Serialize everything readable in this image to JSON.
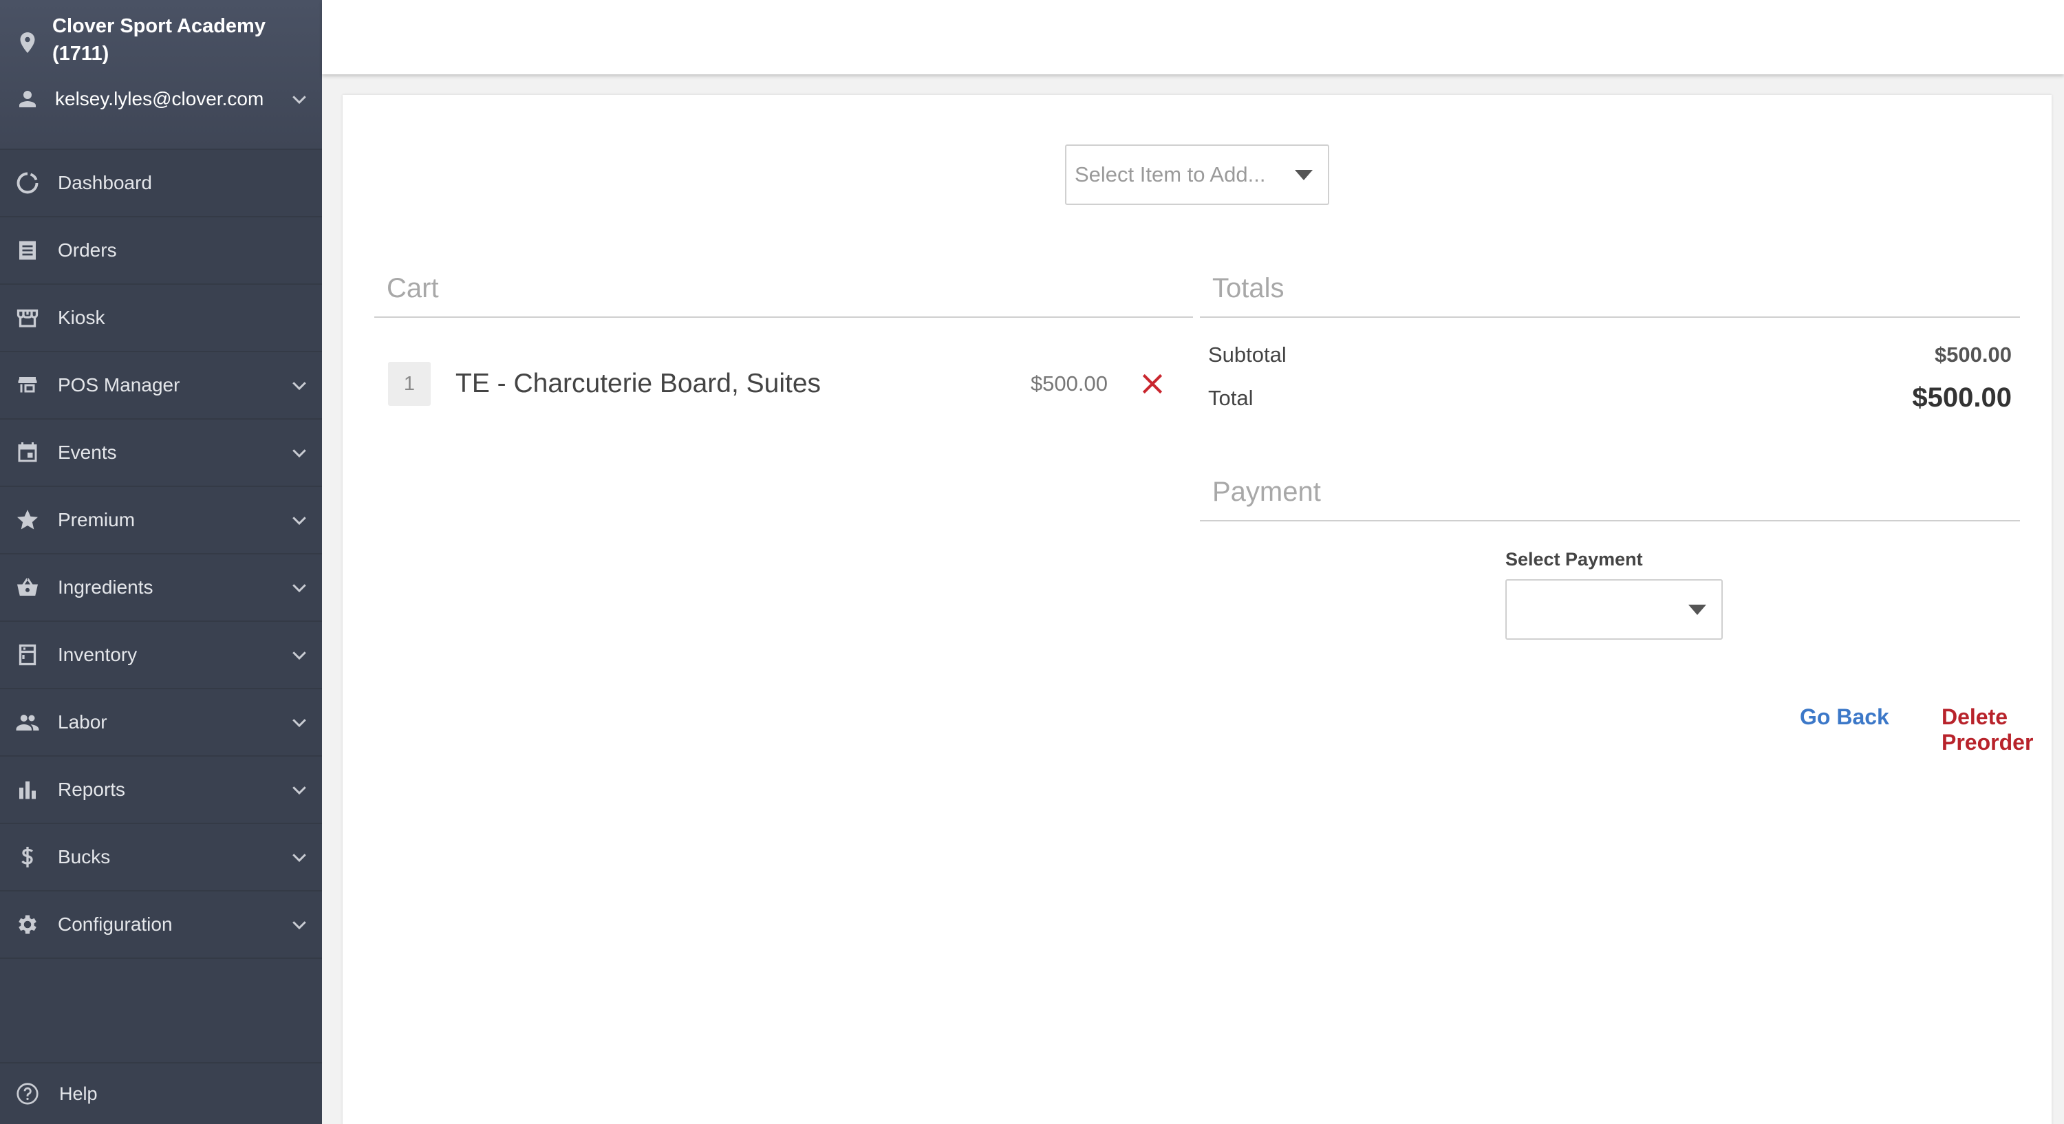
{
  "sidebar": {
    "venue_name": "Clover Sport Academy (1711)",
    "user_email": "kelsey.lyles@clover.com",
    "items": [
      {
        "label": "Dashboard",
        "icon": "dashboard-icon",
        "expandable": false
      },
      {
        "label": "Orders",
        "icon": "orders-icon",
        "expandable": false
      },
      {
        "label": "Kiosk",
        "icon": "kiosk-icon",
        "expandable": false
      },
      {
        "label": "POS Manager",
        "icon": "store-icon",
        "expandable": true
      },
      {
        "label": "Events",
        "icon": "calendar-icon",
        "expandable": true
      },
      {
        "label": "Premium",
        "icon": "star-icon",
        "expandable": true
      },
      {
        "label": "Ingredients",
        "icon": "basket-icon",
        "expandable": true
      },
      {
        "label": "Inventory",
        "icon": "inventory-icon",
        "expandable": true
      },
      {
        "label": "Labor",
        "icon": "people-icon",
        "expandable": true
      },
      {
        "label": "Reports",
        "icon": "bar-chart-icon",
        "expandable": true
      },
      {
        "label": "Bucks",
        "icon": "dollar-icon",
        "expandable": true
      },
      {
        "label": "Configuration",
        "icon": "gear-icon",
        "expandable": true
      }
    ],
    "help_label": "Help"
  },
  "main": {
    "item_select_placeholder": "Select Item to Add...",
    "cart": {
      "heading": "Cart",
      "items": [
        {
          "qty": "1",
          "name": "TE - Charcuterie Board, Suites",
          "price": "$500.00"
        }
      ]
    },
    "totals": {
      "heading": "Totals",
      "subtotal_label": "Subtotal",
      "subtotal_value": "$500.00",
      "total_label": "Total",
      "total_value": "$500.00"
    },
    "payment": {
      "heading": "Payment",
      "select_label": "Select Payment",
      "selected_value": ""
    },
    "actions": {
      "go_back": "Go Back",
      "delete_preorder": "Delete Preorder"
    }
  },
  "colors": {
    "sidebar_bg": "#3a4150",
    "link_blue": "#3c78c8",
    "danger_red": "#b8232b"
  }
}
